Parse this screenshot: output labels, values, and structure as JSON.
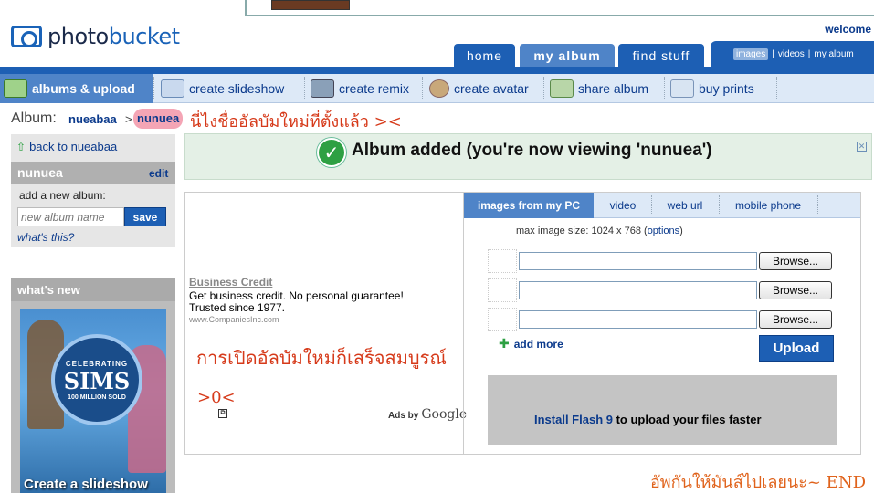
{
  "header": {
    "logo_text_a": "photo",
    "logo_text_b": "bucket",
    "welcome": "welcome"
  },
  "tabs": [
    {
      "label": "home"
    },
    {
      "label": "my album"
    },
    {
      "label": "find stuff"
    }
  ],
  "search_scope": {
    "selected": "images",
    "options": [
      "images",
      "videos",
      "my album"
    ]
  },
  "subnav": [
    {
      "label": "albums & upload",
      "icon": "upload-icon"
    },
    {
      "label": "create slideshow",
      "icon": "slideshow-icon"
    },
    {
      "label": "create remix",
      "icon": "remix-icon"
    },
    {
      "label": "create avatar",
      "icon": "avatar-icon"
    },
    {
      "label": "share album",
      "icon": "share-icon"
    },
    {
      "label": "buy prints",
      "icon": "prints-icon"
    }
  ],
  "breadcrumb": {
    "label": "Album:",
    "user": "nueabaa",
    "separator": ">",
    "album": "nunuea"
  },
  "annotations": {
    "note1": "นี่ไงชื่ออัลบัมใหม่ที่ตั้งแล้ว ><",
    "note2": "การเปิดอัลบัมใหม่ก็เสร็จสมบูรณ์",
    "note3": ">0<",
    "note4": "อัพกันให้มันส์ไปเลยนะ~ END"
  },
  "sidebar": {
    "back_link": "back to nueabaa",
    "album_title": "nunuea",
    "edit": "edit",
    "add_label": "add a new album:",
    "new_album_placeholder": "new album name",
    "save": "save",
    "whats_this": "what's this?",
    "whats_new": "what's new",
    "promo": {
      "badge_top": "CELEBRATING",
      "badge_title": "SIMS",
      "badge_bottom": "100 MILLION SOLD",
      "caption": "Create a slideshow"
    }
  },
  "notice": {
    "text": "Album added (you're now viewing 'nunuea')"
  },
  "ad": {
    "title": "Business Credit",
    "line1": "Get business credit. No personal guarantee!",
    "line2": "Trusted since 1977.",
    "url": "www.CompaniesInc.com",
    "ads_by": "Ads by",
    "google": "Google"
  },
  "upload": {
    "tabs": [
      "images from my PC",
      "video",
      "web url",
      "mobile phone"
    ],
    "max_size_prefix": "max image size: 1024 x 768 (",
    "max_size_link": "options",
    "max_size_suffix": ")",
    "browse_label": "Browse...",
    "add_more": "add more",
    "upload_button": "Upload",
    "flash_link": "Install Flash 9",
    "flash_rest": " to upload your files faster"
  },
  "colors": {
    "brand_blue": "#1d5fb4",
    "active_tab": "#4f84c8",
    "note_red": "#d63a1a",
    "note_orange": "#e0631c"
  }
}
